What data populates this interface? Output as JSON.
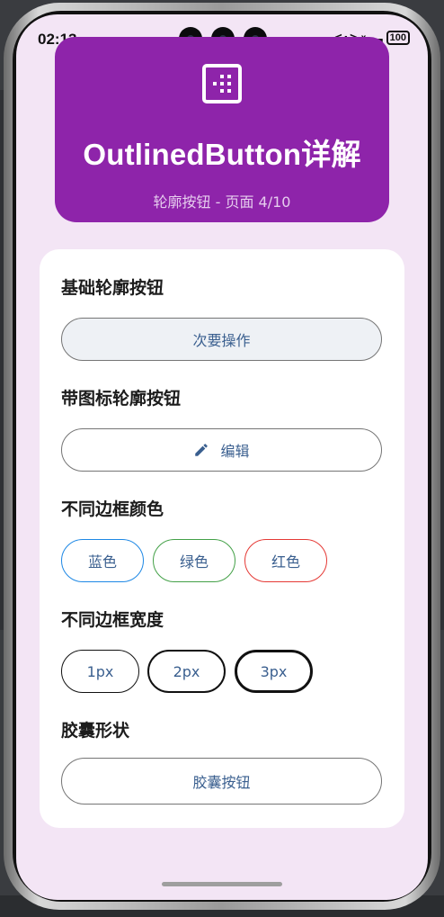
{
  "status_bar": {
    "time": "02:13",
    "network_icon": "<·>",
    "signal_icon": "x▁▂▃",
    "battery": "100"
  },
  "header": {
    "icon": "grid-dots-icon",
    "title": "OutlinedButton详解",
    "subtitle": "轮廓按钮 - 页面 4/10"
  },
  "sections": {
    "basic": {
      "title": "基础轮廓按钮",
      "button": "次要操作"
    },
    "with_icon": {
      "title": "带图标轮廓按钮",
      "button": "编辑",
      "icon": "edit-pencil-icon"
    },
    "border_color": {
      "title": "不同边框颜色",
      "buttons": [
        "蓝色",
        "绿色",
        "红色"
      ],
      "colors": [
        "#1e88e5",
        "#43a047",
        "#e53935"
      ]
    },
    "border_width": {
      "title": "不同边框宽度",
      "buttons": [
        "1px",
        "2px",
        "3px"
      ]
    },
    "capsule": {
      "title": "胶囊形状",
      "button": "胶囊按钮"
    }
  },
  "colors": {
    "header_bg": "#8e24aa",
    "page_bg": "#f3e5f5",
    "button_text": "#3a5f8f"
  }
}
